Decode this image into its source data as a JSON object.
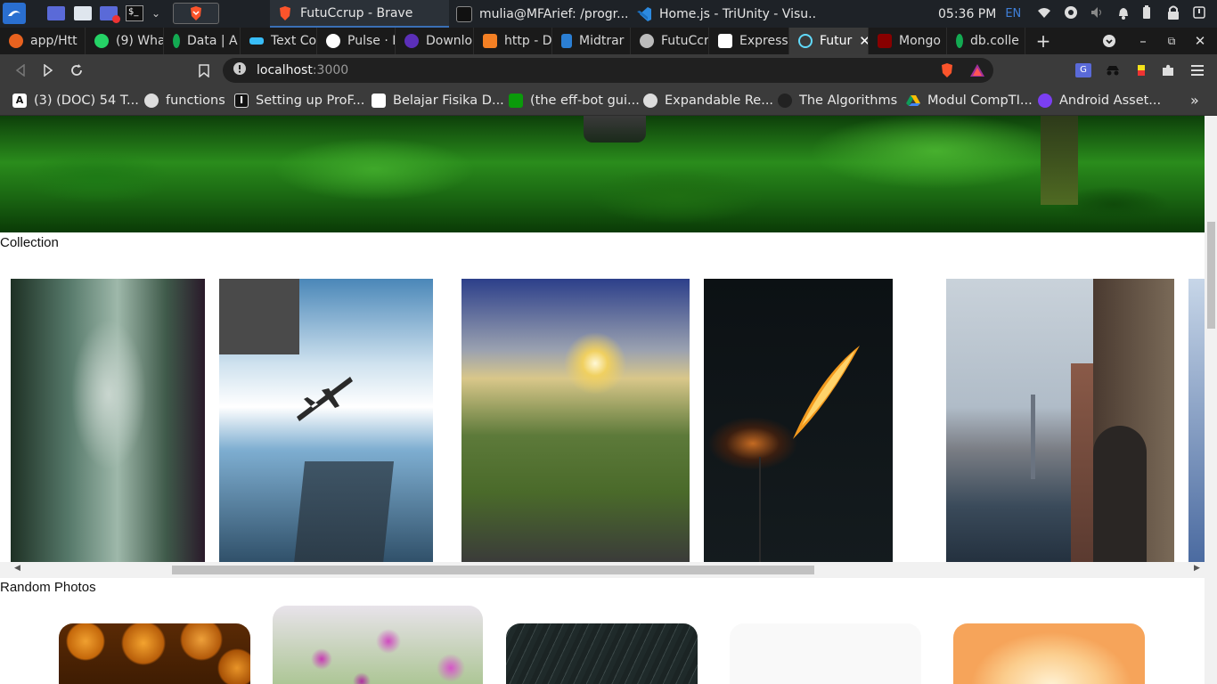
{
  "taskbar": {
    "tasks": [
      {
        "title": "FutuCcrup - Brave",
        "icon": "brave-icon"
      },
      {
        "title": "mulia@MFArief: /progr...",
        "icon": "terminal-icon"
      },
      {
        "title": "Home.js - TriUnity - Visu...",
        "icon": "vscode-icon"
      }
    ],
    "clock": "05:36 PM",
    "keyboard_layout": "EN"
  },
  "browser": {
    "tabs": [
      {
        "label": "app/Htt",
        "icon": "firefox-icon",
        "color": "#e8621f"
      },
      {
        "label": "(9) Wha",
        "icon": "whatsapp-icon",
        "color": "#25d366"
      },
      {
        "label": "Data | A",
        "icon": "mongodb-icon",
        "color": "#13aa52"
      },
      {
        "label": "Text Co",
        "icon": "tailwind-icon",
        "color": "#38bdf8"
      },
      {
        "label": "Pulse · F",
        "icon": "github-icon",
        "color": "#ffffff"
      },
      {
        "label": "Downlo",
        "icon": "download-icon",
        "color": "#5b2fb8"
      },
      {
        "label": "http - D",
        "icon": "stackoverflow-icon",
        "color": "#f48024"
      },
      {
        "label": "Midtrar",
        "icon": "midtrans-icon",
        "color": "#2b7fd4"
      },
      {
        "label": "FutuCcr",
        "icon": "globe-icon",
        "color": "#bbbbbb"
      },
      {
        "label": "Express",
        "icon": "express-icon",
        "color": "#ffffff"
      },
      {
        "label": "Futur",
        "icon": "react-icon",
        "color": "#61dafb",
        "active": true
      },
      {
        "label": "Mongo",
        "icon": "mongoose-icon",
        "color": "#880000"
      },
      {
        "label": "db.colle",
        "icon": "mongodb-icon",
        "color": "#13aa52"
      }
    ],
    "url_host": "localhost",
    "url_port": ":3000",
    "bookmarks": [
      {
        "label": "(3) (DOC) 54 T...",
        "icon": "academia-icon"
      },
      {
        "label": "functions",
        "icon": "globe-icon"
      },
      {
        "label": "Setting up ProF...",
        "icon": "bookmark-icon"
      },
      {
        "label": "Belajar Fisika D...",
        "icon": "physics-icon"
      },
      {
        "label": "(the eff-bot gui...",
        "icon": "effbot-icon"
      },
      {
        "label": "Expandable Re...",
        "icon": "globe-icon"
      },
      {
        "label": "The Algorithms",
        "icon": "github-icon"
      },
      {
        "label": "Modul CompTI...",
        "icon": "google-drive-icon"
      },
      {
        "label": "Android Asset...",
        "icon": "android-asset-icon"
      }
    ]
  },
  "page": {
    "collection_title": "Collection",
    "random_title": "Random Photos",
    "collection_photos": [
      {
        "name": "forest-photo",
        "colors": [
          "#2f4a3a",
          "#9fb7a8",
          "#3a2a3a"
        ]
      },
      {
        "name": "airplane-sky-photo",
        "colors": [
          "#6ea3c9",
          "#e7eef3",
          "#2f5570"
        ]
      },
      {
        "name": "valley-sunrise-photo",
        "colors": [
          "#3c4b8c",
          "#e8d27a",
          "#4b6a2a"
        ]
      },
      {
        "name": "burning-dandelion-photo",
        "colors": [
          "#0b1012",
          "#f08a1a",
          "#1a2225"
        ]
      },
      {
        "name": "city-rooftop-photo",
        "colors": [
          "#b6c1cc",
          "#7a5a4a",
          "#2a3a4a"
        ]
      }
    ],
    "random_photos": [
      {
        "name": "pumpkins-photo",
        "colors": [
          "#e08a1a",
          "#b95f0a"
        ]
      },
      {
        "name": "flowers-photo",
        "colors": [
          "#c840b8",
          "#6a9a4a"
        ]
      },
      {
        "name": "rain-photo",
        "colors": [
          "#1f2a2a",
          "#4a5555"
        ]
      },
      {
        "name": "white-photo",
        "colors": [
          "#fafafa",
          "#f2f2f2"
        ]
      },
      {
        "name": "peach-gradient-photo",
        "colors": [
          "#fde2b0",
          "#f6a45a"
        ]
      }
    ]
  }
}
